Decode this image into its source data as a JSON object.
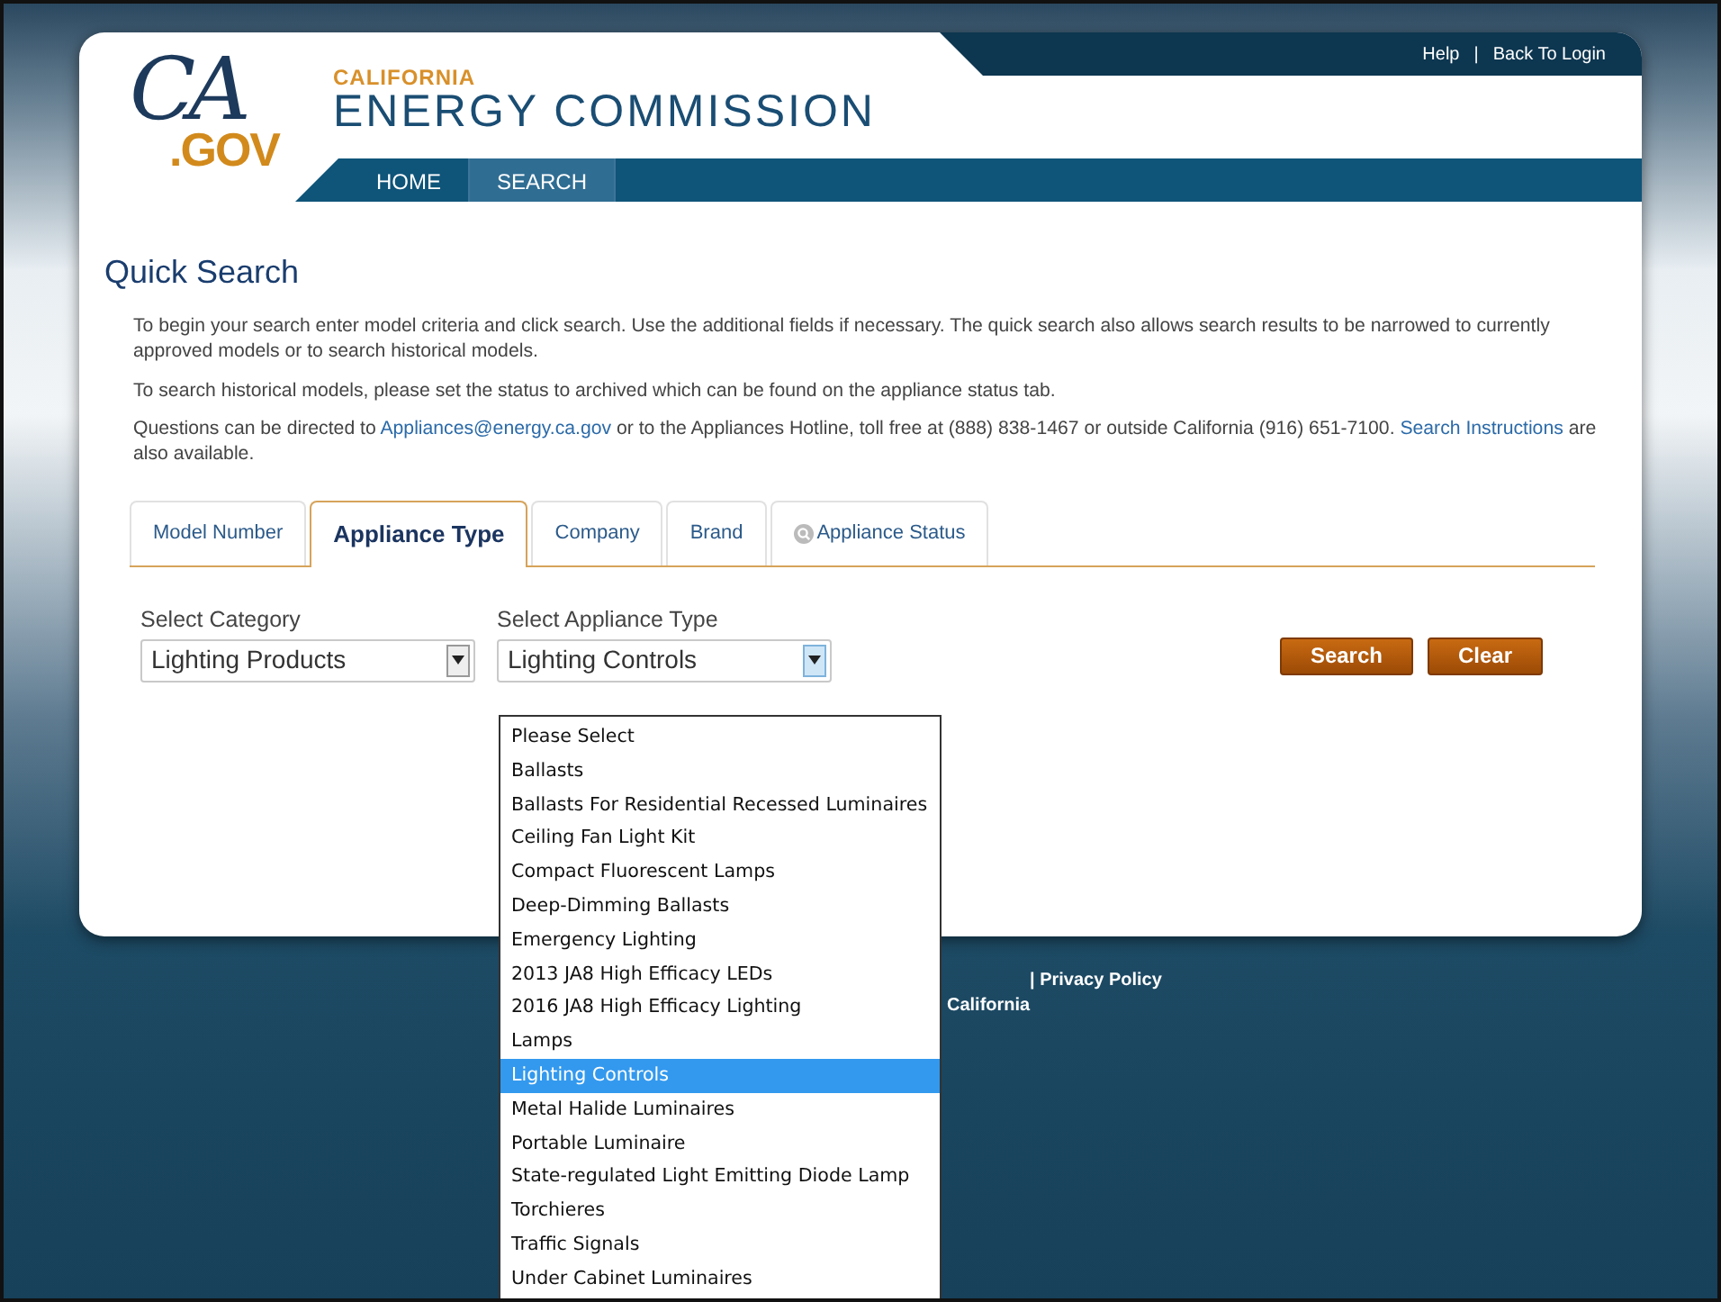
{
  "header": {
    "logo": {
      "script": "CA",
      "suffix": ".GOV"
    },
    "agency": {
      "state": "CALIFORNIA",
      "name": "ENERGY COMMISSION"
    },
    "utility_links": [
      "Help",
      "|",
      "Back To Login"
    ],
    "nav": [
      {
        "label": "HOME",
        "selected": false
      },
      {
        "label": "SEARCH",
        "selected": true
      }
    ]
  },
  "page_title": "Quick Search",
  "paragraphs": [
    "To begin your search enter model criteria and click search. Use the additional fields if necessary. The quick search also allows search results to be narrowed to currently approved models or to search historical models.",
    "To search historical models, please set the status to archived which can be found on the appliance status tab.",
    [
      {
        "kind": "text",
        "text": "Questions can be directed to "
      },
      {
        "kind": "link",
        "text": "Appliances@energy.ca.gov"
      },
      {
        "kind": "text",
        "text": " or to the Appliances Hotline, toll free at (888) 838-1467 or outside California (916) 651-7100. "
      },
      {
        "kind": "link",
        "text": "Search Instructions"
      },
      {
        "kind": "text",
        "text": " are also available."
      }
    ]
  ],
  "tabs": [
    {
      "label": "Model Number",
      "selected": false,
      "kind": "plain"
    },
    {
      "label": "Appliance Type",
      "selected": true,
      "kind": "plain"
    },
    {
      "label": "Company",
      "selected": false,
      "kind": "plain"
    },
    {
      "label": "Brand",
      "selected": false,
      "kind": "plain"
    },
    {
      "label": "Appliance Status",
      "selected": false,
      "kind": "icon"
    }
  ],
  "fields": [
    {
      "label": "Select Category",
      "value": "Lighting Products",
      "focused": false
    },
    {
      "label": "Select Appliance Type",
      "value": "Lighting Controls",
      "focused": true
    }
  ],
  "buttons": [
    "Search",
    "Clear"
  ],
  "dropdown": {
    "options": [
      {
        "label": "Please Select",
        "selected": false
      },
      {
        "label": "Ballasts",
        "selected": false
      },
      {
        "label": "Ballasts For Residential Recessed Luminaires",
        "selected": false
      },
      {
        "label": "Ceiling Fan Light Kit",
        "selected": false
      },
      {
        "label": "Compact Fluorescent Lamps",
        "selected": false
      },
      {
        "label": "Deep-Dimming Ballasts",
        "selected": false
      },
      {
        "label": "Emergency Lighting",
        "selected": false
      },
      {
        "label": "2013 JA8 High Efficacy LEDs",
        "selected": false
      },
      {
        "label": "2016 JA8 High Efficacy Lighting",
        "selected": false
      },
      {
        "label": "Lamps",
        "selected": false
      },
      {
        "label": "Lighting Controls",
        "selected": true
      },
      {
        "label": "Metal Halide Luminaires",
        "selected": false
      },
      {
        "label": "Portable Luminaire",
        "selected": false
      },
      {
        "label": "State-regulated Light Emitting Diode Lamp",
        "selected": false
      },
      {
        "label": "Torchieres",
        "selected": false
      },
      {
        "label": "Traffic Signals",
        "selected": false
      },
      {
        "label": "Under Cabinet Luminaires",
        "selected": false
      }
    ]
  },
  "footer": {
    "line_1": "|  Privacy Policy",
    "line_2": "California"
  }
}
